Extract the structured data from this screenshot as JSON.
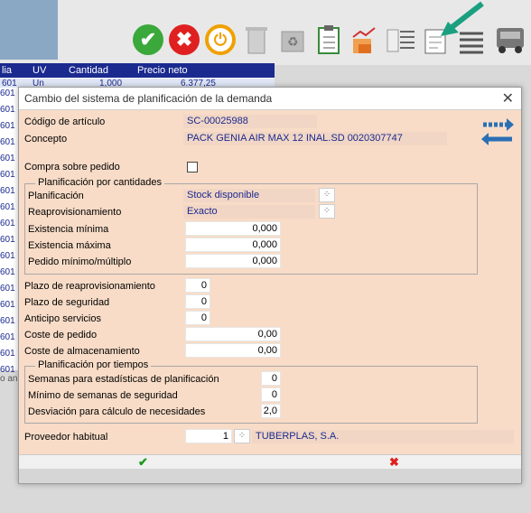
{
  "toolbar": {
    "accept_icon": "check-circle-icon",
    "cancel_icon": "x-circle-icon",
    "exit_icon": "power-icon",
    "delete_icon": "trash-icon",
    "recycle_icon": "recycle-icon",
    "clipboard_icon": "clipboard-icon",
    "chart_icon": "chart-boxes-icon",
    "list_icon": "list-icon",
    "form_icon": "form-edit-icon",
    "menu_icon": "menu-lines-icon",
    "truck_icon": "truck-icon"
  },
  "bg_table": {
    "headers": [
      "lia",
      "UV",
      "Cantidad",
      "Precio neto"
    ],
    "first_row": {
      "uv": "Un",
      "cantidad": "1,000",
      "precio": "6.377,25"
    },
    "row_prefix": "601",
    "partial_text": "o an"
  },
  "dialog": {
    "title": "Cambio del sistema de planificación de la demanda",
    "close": "✕",
    "codigo_label": "Código de artículo",
    "codigo_value": "SC-00025988",
    "concepto_label": "Concepto",
    "concepto_value": "PACK GENIA AIR MAX 12 INAL.SD 0020307747",
    "compra_label": "Compra sobre pedido",
    "group_cantidades": "Planificación por cantidades",
    "planificacion_label": "Planificación",
    "planificacion_value": "Stock disponible",
    "reaprov_label": "Reaprovisionamiento",
    "reaprov_value": "Exacto",
    "existencia_min_label": "Existencia mínima",
    "existencia_min_value": "0,000",
    "existencia_max_label": "Existencia máxima",
    "existencia_max_value": "0,000",
    "pedido_min_label": "Pedido mínimo/múltiplo",
    "pedido_min_value": "0,000",
    "plazo_reaprov_label": "Plazo de reaprovisionamiento",
    "plazo_reaprov_value": "0",
    "plazo_seg_label": "Plazo de seguridad",
    "plazo_seg_value": "0",
    "anticipo_label": "Anticipo servicios",
    "anticipo_value": "0",
    "coste_pedido_label": "Coste de pedido",
    "coste_pedido_value": "0,00",
    "coste_alm_label": "Coste de almacenamiento",
    "coste_alm_value": "0,00",
    "group_tiempos": "Planificación por tiempos",
    "semanas_est_label": "Semanas para estadísticas de planificación",
    "semanas_est_value": "0",
    "min_semanas_label": "Mínimo de semanas de seguridad",
    "min_semanas_value": "0",
    "desviacion_label": "Desviación para cálculo de necesidades",
    "desviacion_value": "2,0",
    "proveedor_label": "Proveedor habitual",
    "proveedor_code": "1",
    "proveedor_name": "TUBERPLAS, S.A.",
    "ok_glyph": "✔",
    "cancel_glyph": "✖"
  },
  "colors": {
    "accent_blue": "#1b2a8f",
    "dialog_bg": "#f8dcc7",
    "green": "#3aa83a",
    "red": "#e02020",
    "orange": "#f0a000",
    "arrow_green": "#1aa080"
  }
}
